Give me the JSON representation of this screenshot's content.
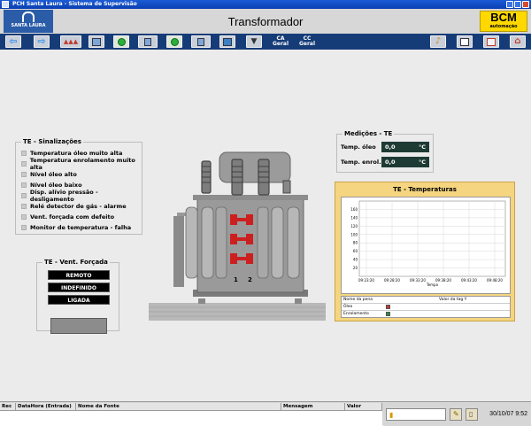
{
  "window": {
    "title": "PCH Santa Laura - Sistema de Supervisão"
  },
  "header": {
    "logo_text": "SANTA LAURA",
    "page_title": "Transformador",
    "brand": "BCM",
    "brand_sub": "automação"
  },
  "toolbar": {
    "items": [
      {
        "icon": "arrow-left-icon"
      },
      {
        "icon": "arrow-right-icon"
      },
      {
        "icon": "switchgear-icon"
      },
      {
        "icon": "cubicle-icon"
      },
      {
        "icon": "generator-1-icon",
        "label": "G1"
      },
      {
        "icon": "unit-1-icon",
        "label": "U1"
      },
      {
        "icon": "generator-2-icon",
        "label": "G2"
      },
      {
        "icon": "unit-2-icon",
        "label": "U2"
      },
      {
        "icon": "panel-icon"
      },
      {
        "icon": "transformer-icon"
      }
    ],
    "ca_geral": "CA Geral",
    "cc_geral": "CC Geral",
    "right_icons": [
      "bell-icon",
      "report-icon",
      "trend-icon",
      "home-icon"
    ]
  },
  "signals": {
    "title": "TE - Sinalizações",
    "items": [
      "Temperatura óleo muito alta",
      "Temperatura enrolamento muito alta",
      "Nível óleo alto",
      "Nível óleo baixo",
      "Disp. alívio pressão - desligamento",
      "Relé detector de gás - alarme",
      "Vent. forçada com defeito",
      "Monitor de temperatura - falha"
    ]
  },
  "vent": {
    "title": "TE - Vent. Forçada",
    "buttons": [
      "REMOTO",
      "INDEFINIDO",
      "LIGADA"
    ]
  },
  "measurements": {
    "title": "Medições - TE",
    "rows": [
      {
        "label": "Temp. óleo",
        "value": "0,0",
        "unit": "°C"
      },
      {
        "label": "Temp. enrol.",
        "value": "0,0",
        "unit": "°C"
      }
    ]
  },
  "transformer": {
    "label_1": "1",
    "label_2": "2"
  },
  "chart_data": {
    "type": "line",
    "title": "TE - Temperaturas",
    "xlabel": "Tempo",
    "ylabel": "",
    "ylim": [
      0,
      180
    ],
    "yticks": [
      20,
      40,
      60,
      80,
      100,
      120,
      140,
      160
    ],
    "x_ticks": [
      "09:23:20",
      "09:28:20",
      "09:33:20",
      "09:38:20",
      "09:43:20",
      "09:48:20"
    ],
    "grid": true,
    "series": [
      {
        "name": "Óleo",
        "color": "#c0392b",
        "values": []
      },
      {
        "name": "Enrolamento",
        "color": "#2e8b3e",
        "values": []
      }
    ],
    "legend_headers": [
      "Nome da pena",
      "Valor da tag Y"
    ]
  },
  "statusbar": {
    "columns": [
      "Rec",
      "DataHora (Entrada)",
      "Nome da Fonte",
      "Mensagem",
      "Valor"
    ],
    "datetime": "30/10/07 9:52"
  }
}
